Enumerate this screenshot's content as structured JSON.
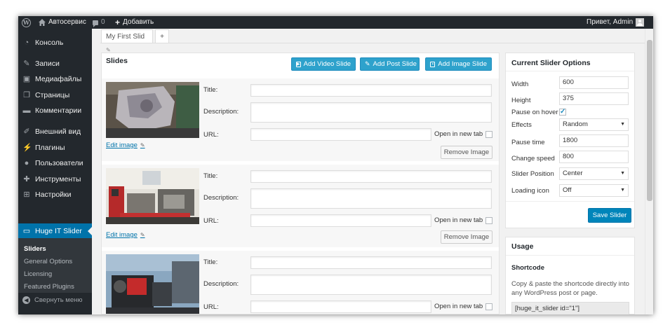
{
  "adminbar": {
    "site_name": "Автосервис",
    "comments_count": "0",
    "add_new": "Добавить",
    "greeting": "Привет, Admin"
  },
  "menu": {
    "items": [
      {
        "label": "Консоль",
        "icon": "dashboard-icon"
      },
      {
        "label": "Записи",
        "icon": "pin-icon"
      },
      {
        "label": "Медиафайлы",
        "icon": "media-icon"
      },
      {
        "label": "Страницы",
        "icon": "pages-icon"
      },
      {
        "label": "Комментарии",
        "icon": "comments-icon"
      },
      {
        "label": "Внешний вид",
        "icon": "appearance-icon"
      },
      {
        "label": "Плагины",
        "icon": "plugins-icon"
      },
      {
        "label": "Пользователи",
        "icon": "users-icon"
      },
      {
        "label": "Инструменты",
        "icon": "tools-icon"
      },
      {
        "label": "Настройки",
        "icon": "settings-icon"
      },
      {
        "label": "Huge IT Slider",
        "icon": "slider-icon"
      }
    ],
    "submenu": [
      "Sliders",
      "General Options",
      "Licensing",
      "Featured Plugins"
    ],
    "collapse": "Свернуть меню"
  },
  "tabs": {
    "slider_name": "My First Slid",
    "add_tab": "+"
  },
  "slides_panel": {
    "title": "Slides",
    "add_video": "Add Video Slide",
    "add_post": "Add Post Slide",
    "add_image": "Add Image Slide",
    "title_label": "Title:",
    "description_label": "Description:",
    "url_label": "URL:",
    "new_tab_label": "Open in new tab",
    "edit_image": "Edit image",
    "remove_image": "Remove Image"
  },
  "options": {
    "title": "Current Slider Options",
    "width_label": "Width",
    "width": "600",
    "height_label": "Height",
    "height": "375",
    "pause_hover_label": "Pause on hover",
    "pause_hover_checked": true,
    "effects_label": "Effects",
    "effects": "Random",
    "pause_time_label": "Pause time",
    "pause_time": "1800",
    "change_speed_label": "Change speed",
    "change_speed": "800",
    "position_label": "Slider Position",
    "position": "Center",
    "loading_icon_label": "Loading icon",
    "loading_icon": "Off",
    "save": "Save Slider"
  },
  "usage": {
    "title": "Usage",
    "shortcode_title": "Shortcode",
    "description": "Copy & paste the shortcode directly into any WordPress post or page.",
    "shortcode": "[huge_it_slider id=\"1\"]"
  },
  "colors": {
    "admin_bar": "#23282d",
    "accent": "#0073aa",
    "button": "#2ea2cc"
  }
}
